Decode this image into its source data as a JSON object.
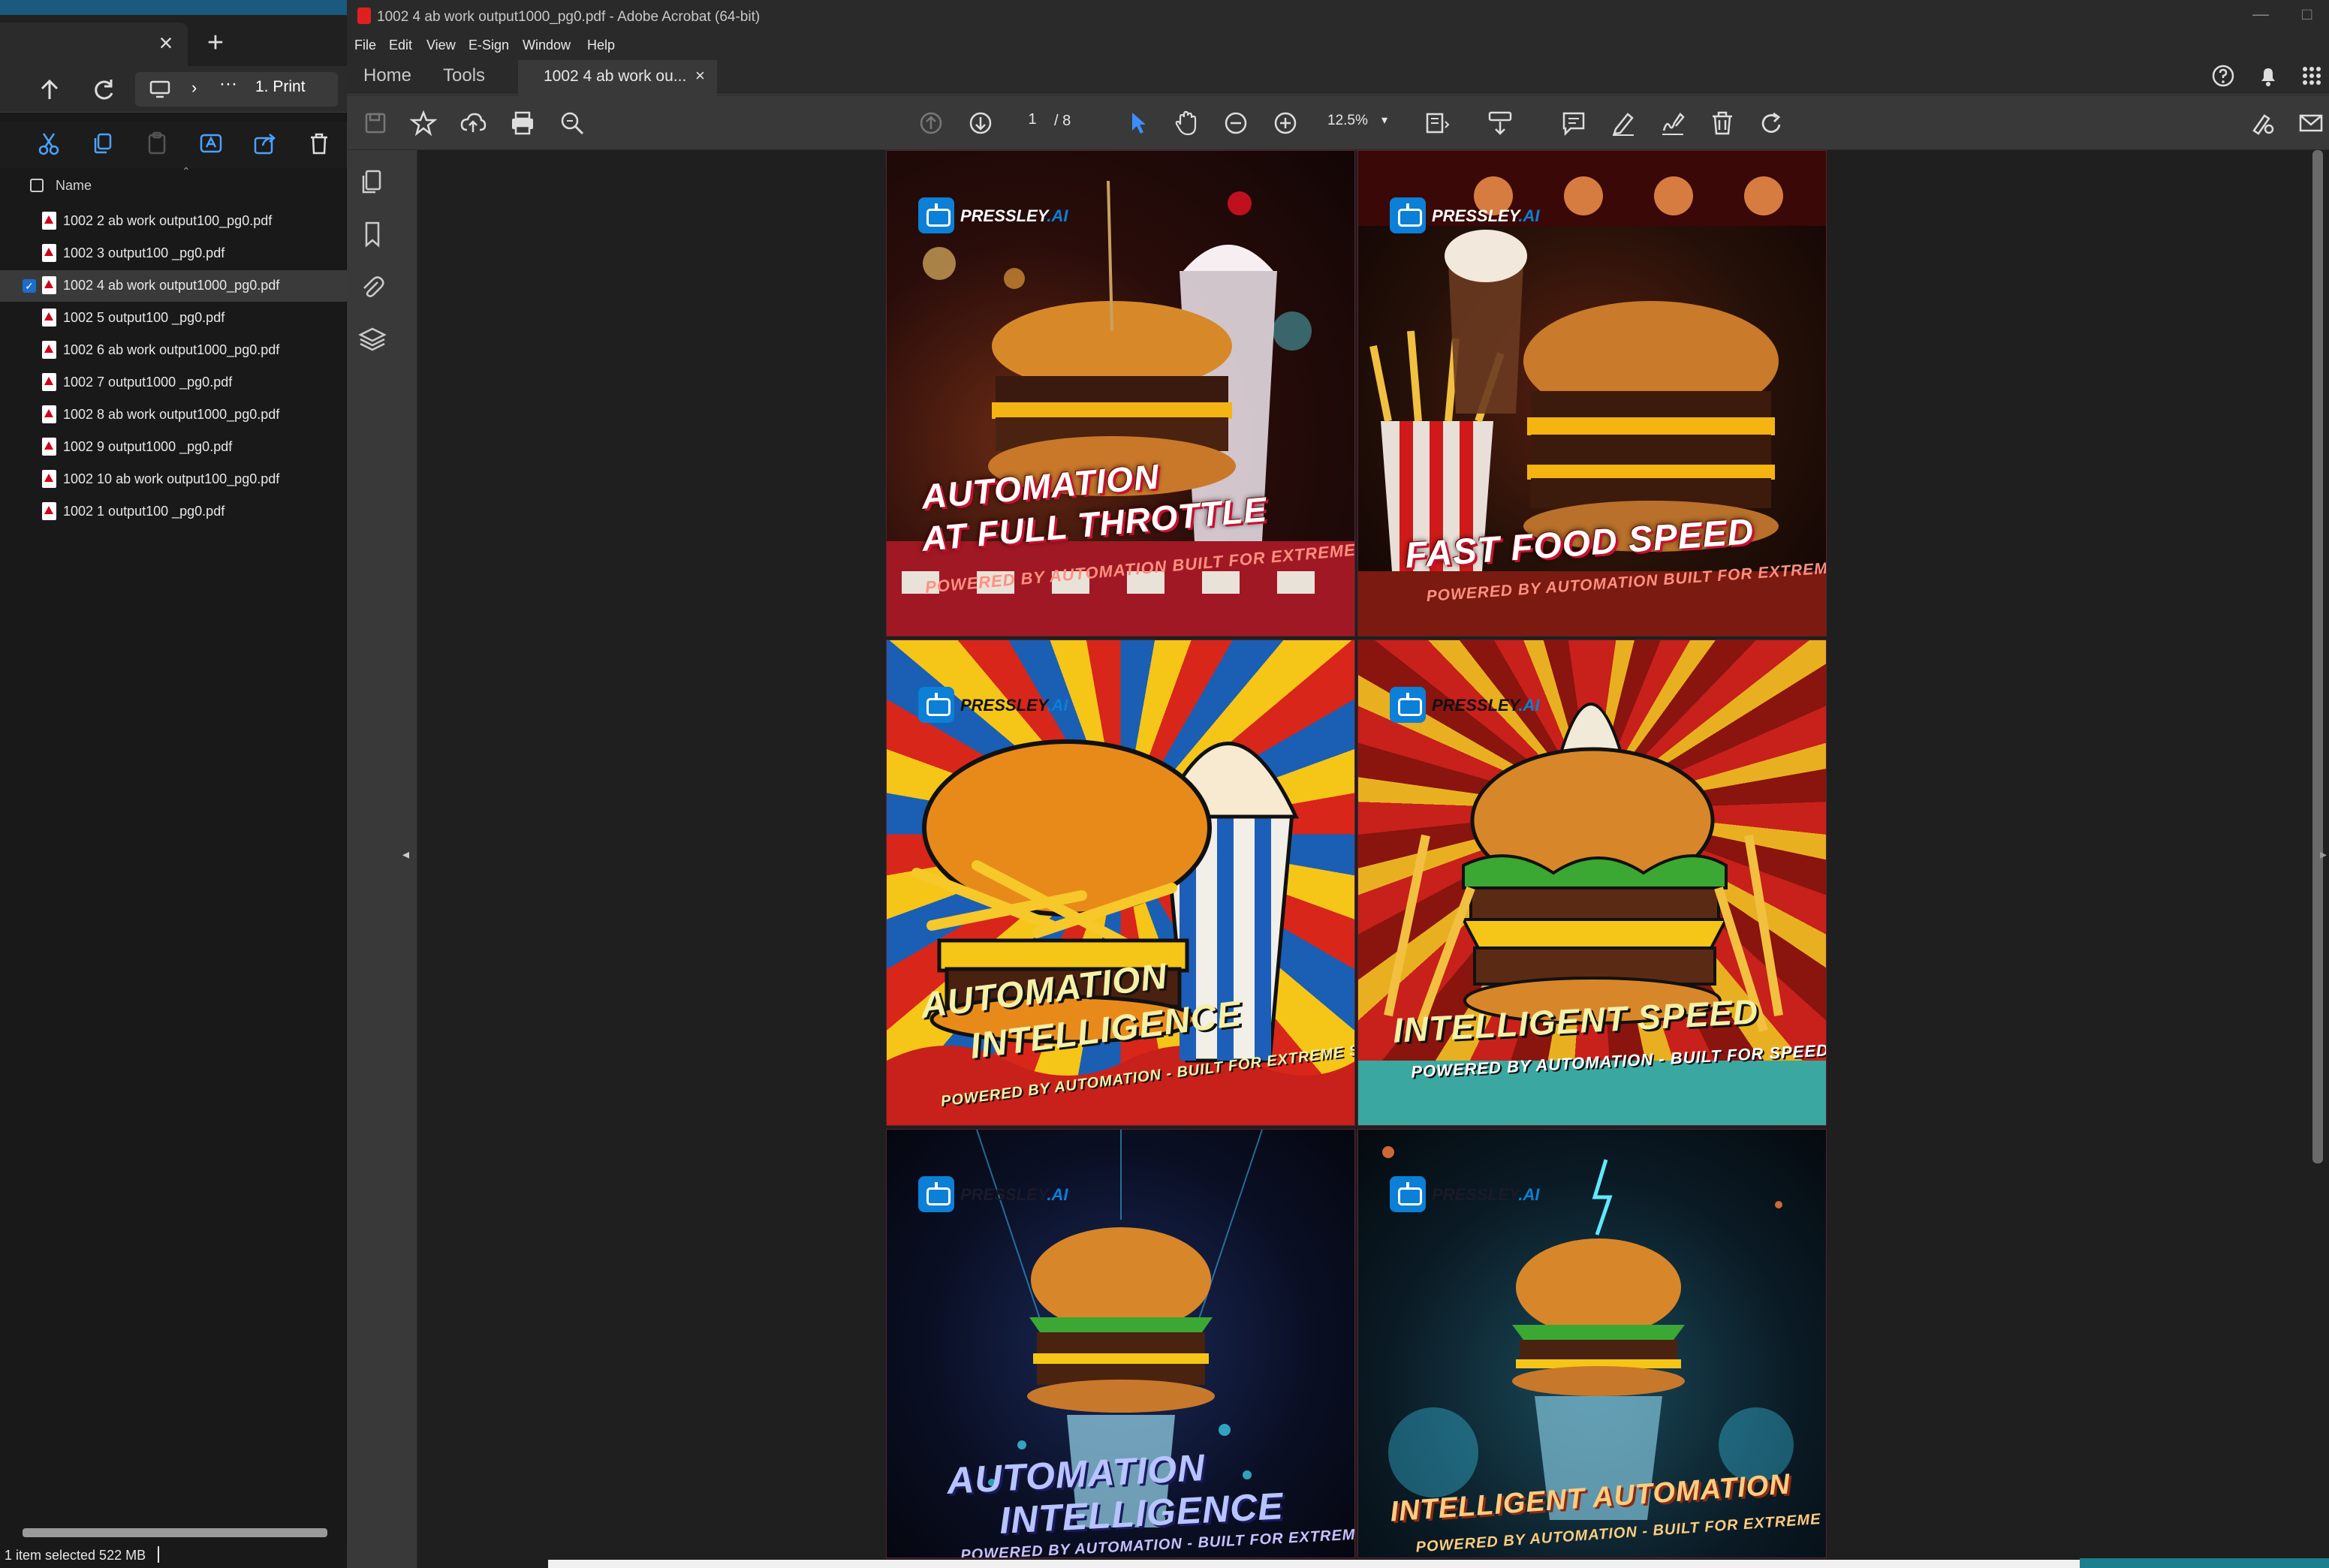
{
  "explorer": {
    "tab_close": "×",
    "tab_add": "+",
    "breadcrumb": "1. Print",
    "ellipsis": "···",
    "chevron": "›",
    "column_name": "Name",
    "files": [
      {
        "name": "1002  2 ab work output100_pg0.pdf",
        "selected": false
      },
      {
        "name": "1002  3 output100 _pg0.pdf",
        "selected": false
      },
      {
        "name": "1002  4 ab work output1000_pg0.pdf",
        "selected": true
      },
      {
        "name": "1002  5 output100 _pg0.pdf",
        "selected": false
      },
      {
        "name": "1002  6 ab work output1000_pg0.pdf",
        "selected": false
      },
      {
        "name": "1002  7 output1000 _pg0.pdf",
        "selected": false
      },
      {
        "name": "1002  8 ab work output1000_pg0.pdf",
        "selected": false
      },
      {
        "name": "1002  9 output1000 _pg0.pdf",
        "selected": false
      },
      {
        "name": "1002  10 ab work output100_pg0.pdf",
        "selected": false
      },
      {
        "name": "1002 1 output100 _pg0.pdf",
        "selected": false
      }
    ],
    "status": "1 item selected  522 MB"
  },
  "acrobat": {
    "window_title": "1002  4 ab work output1000_pg0.pdf - Adobe Acrobat (64-bit)",
    "menu": [
      "File",
      "Edit",
      "View",
      "E-Sign",
      "Window",
      "Help"
    ],
    "tabs": {
      "home": "Home",
      "tools": "Tools",
      "document": "1002  4 ab work ou...",
      "close": "×"
    },
    "page_current": "1",
    "page_total": "/  8",
    "zoom": "12.5%",
    "window_min": "—",
    "window_max": "□"
  },
  "pages": [
    {
      "logo": "PRESSLEY",
      "logo_ai": ".AI",
      "title": "AUTOMATION",
      "title2": "AT FULL THROTTLE",
      "subtitle": "POWERED BY AUTOMATION BUILT FOR EXTREME SPEED"
    },
    {
      "logo": "PRESSLEY",
      "logo_ai": ".AI",
      "title": "FAST FOOD SPEED",
      "title2": "",
      "subtitle": "POWERED BY AUTOMATION BUILT FOR EXTREME SPEED"
    },
    {
      "logo": "PRESSLEY",
      "logo_ai": ".AI",
      "title": "AUTOMATION",
      "title2": "INTELLIGENCE",
      "subtitle": "POWERED BY AUTOMATION - BUILT FOR EXTREME SPEED"
    },
    {
      "logo": "PRESSLEY",
      "logo_ai": ".AI",
      "title": "INTELLIGENT SPEED",
      "title2": "",
      "subtitle": "POWERED BY AUTOMATION - BUILT FOR SPEED"
    },
    {
      "logo": "PRESSLEY",
      "logo_ai": ".AI",
      "title": "AUTOMATION",
      "title2": "INTELLIGENCE",
      "subtitle": "POWERED BY AUTOMATION - BUILT FOR EXTREME SPEED"
    },
    {
      "logo": "PRESSLEY",
      "logo_ai": ".AI",
      "title": "INTELLIGENT AUTOMATION",
      "title2": "",
      "subtitle": "POWERED BY AUTOMATION - BUILT FOR EXTREME SPEED"
    }
  ],
  "colors": {
    "accent": "#0c7fd6",
    "title_shadow": "#c8102e",
    "acrobat_red": "#e02020"
  }
}
